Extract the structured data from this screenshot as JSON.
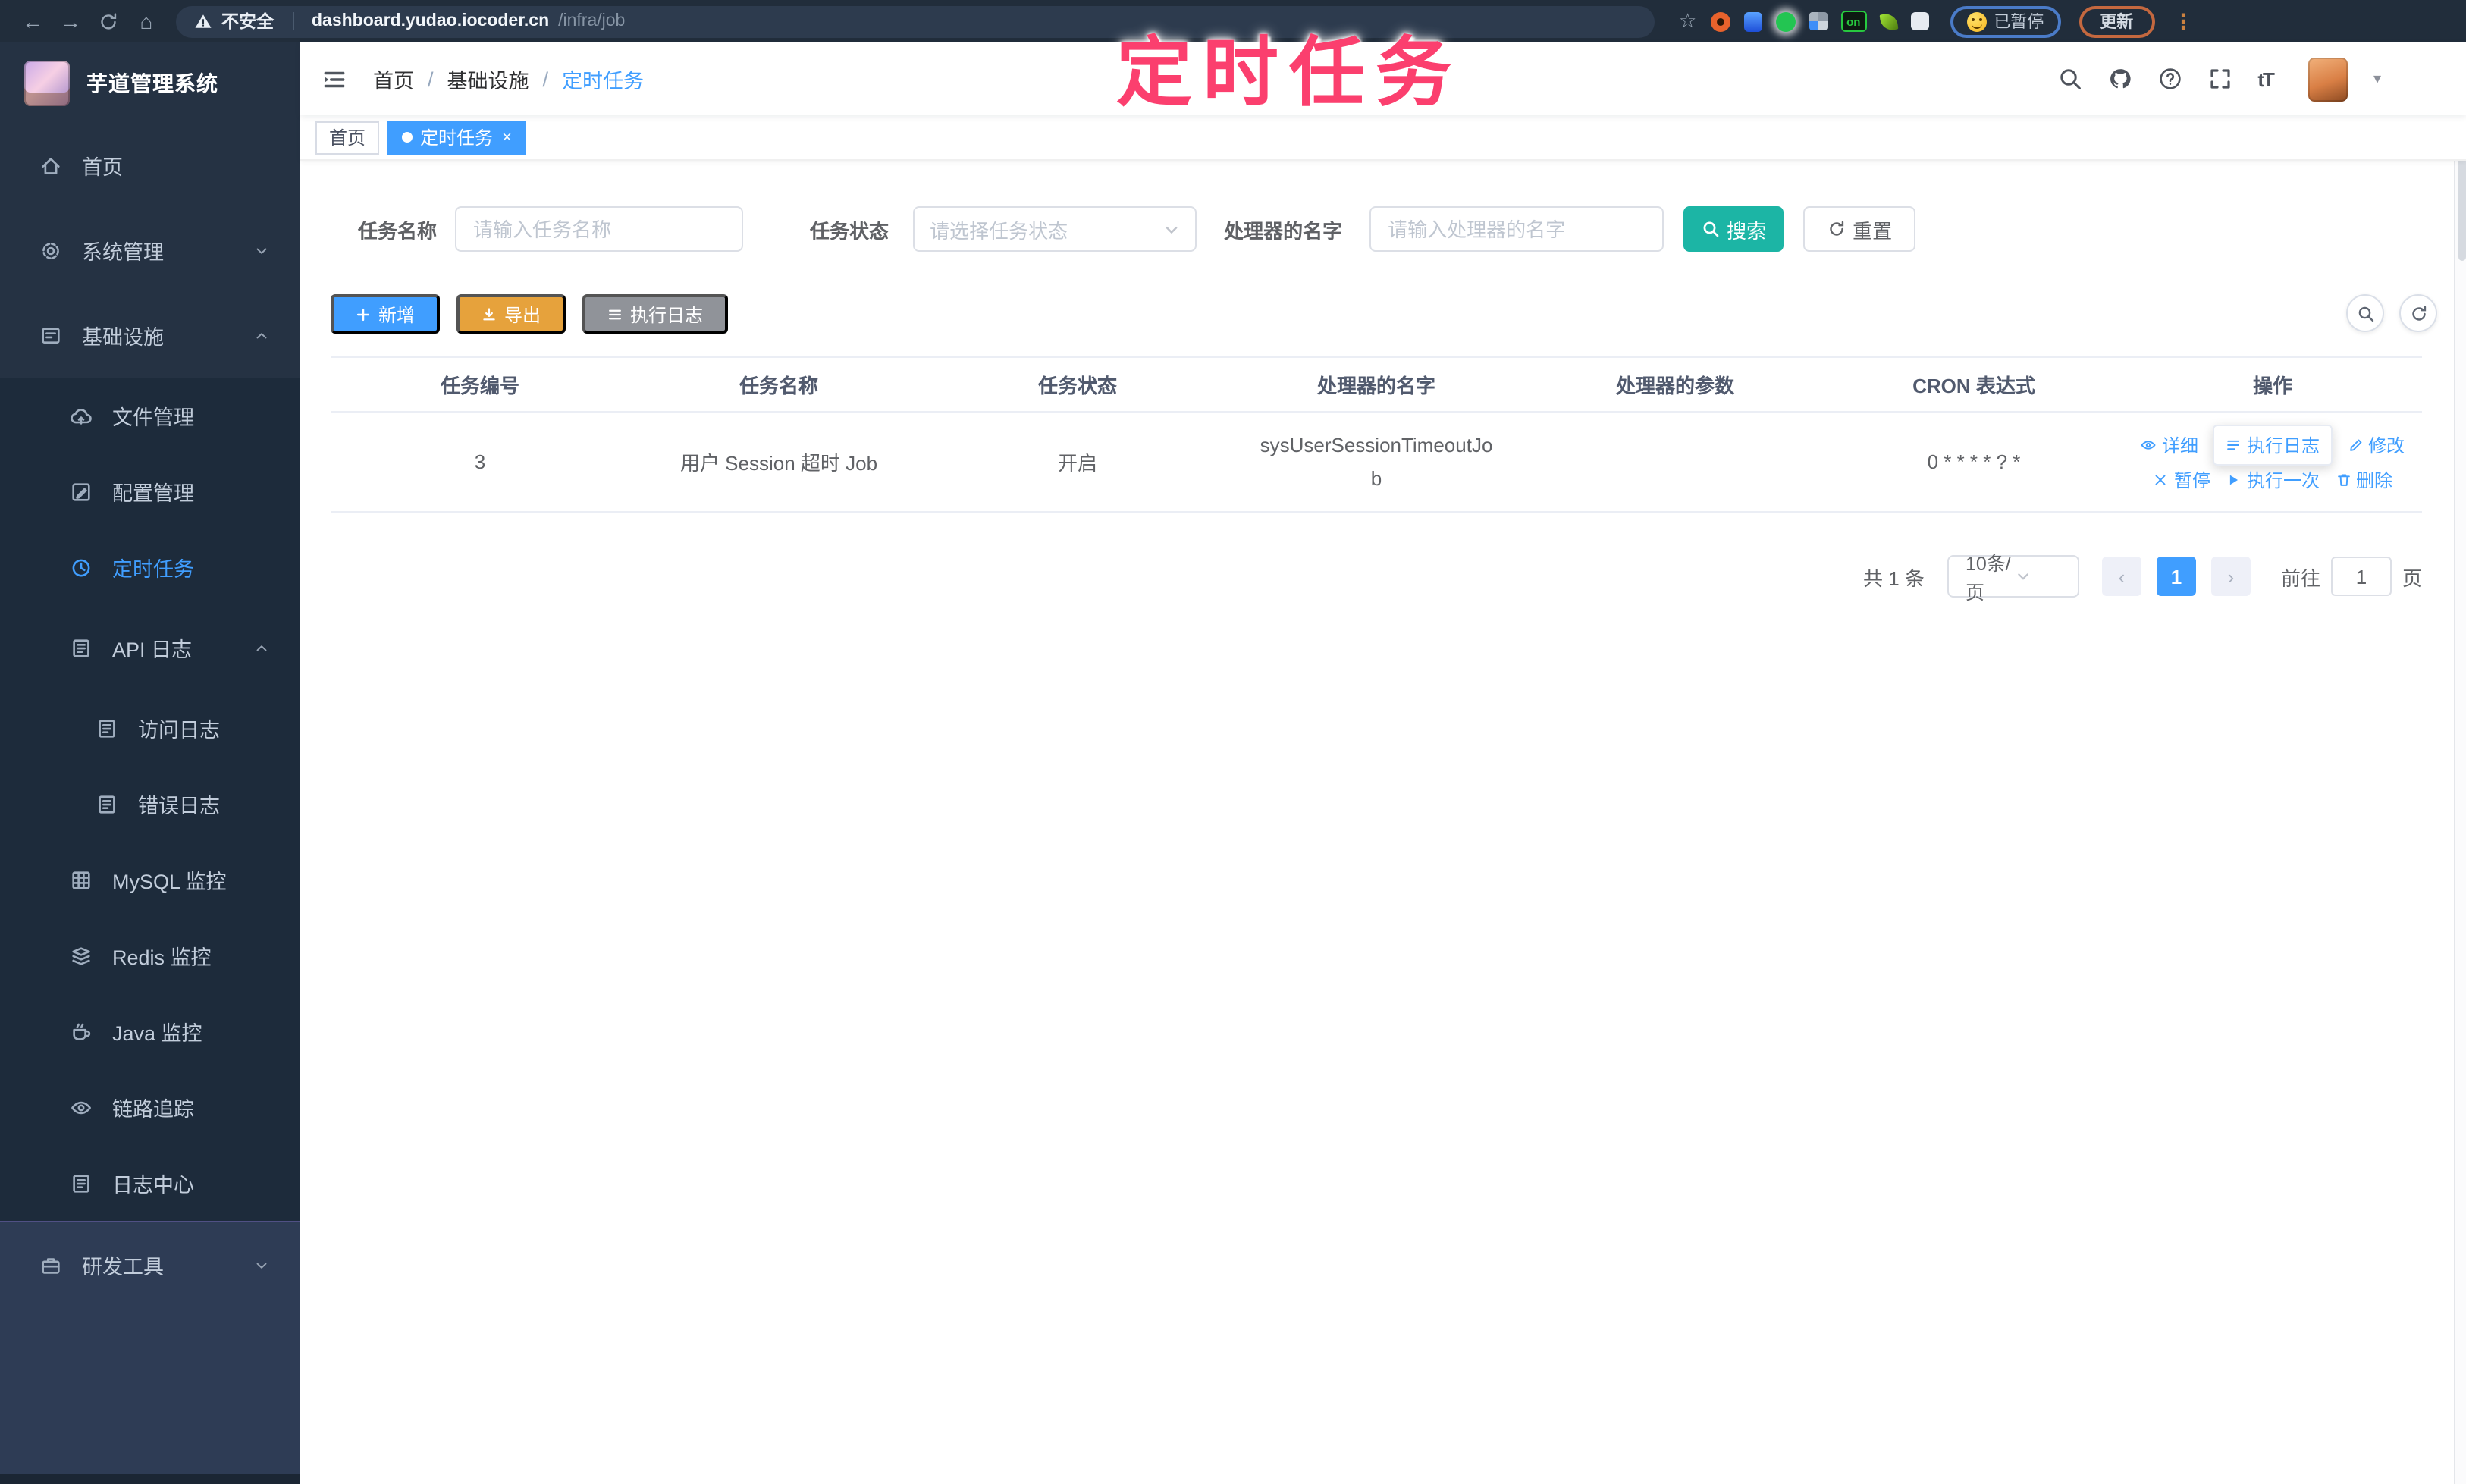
{
  "browser": {
    "security_label": "不安全",
    "url_host": "dashboard.yudao.iocoder.cn",
    "url_path": "/infra/job",
    "extensions_badge": "on",
    "profile_paused": "已暂停",
    "update_button": "更新"
  },
  "annotation": {
    "text": "定时任务"
  },
  "sidebar": {
    "title": "芋道管理系统",
    "menu": [
      {
        "key": "home",
        "label": "首页",
        "icon": "home-icon",
        "level": 0,
        "zone": "top"
      },
      {
        "key": "system-mgmt",
        "label": "系统管理",
        "icon": "gear-icon",
        "level": 0,
        "zone": "top",
        "arrow": "down"
      },
      {
        "key": "infra",
        "label": "基础设施",
        "icon": "infra-board-icon",
        "level": 0,
        "zone": "top",
        "arrow": "up"
      },
      {
        "key": "file-mgmt",
        "label": "文件管理",
        "icon": "cloud-upload-icon",
        "level": 1,
        "zone": "sub"
      },
      {
        "key": "config-mgmt",
        "label": "配置管理",
        "icon": "config-edit-icon",
        "level": 1,
        "zone": "sub"
      },
      {
        "key": "job",
        "label": "定时任务",
        "icon": "clock-icon",
        "level": 1,
        "zone": "sub",
        "active": true
      },
      {
        "key": "api-log",
        "label": "API 日志",
        "icon": "api-log-icon",
        "level": 1,
        "zone": "sub",
        "arrow": "up",
        "tall": true
      },
      {
        "key": "access-log",
        "label": "访问日志",
        "icon": "access-log-icon",
        "level": 2,
        "zone": "sub"
      },
      {
        "key": "error-log",
        "label": "错误日志",
        "icon": "error-log-icon",
        "level": 2,
        "zone": "sub"
      },
      {
        "key": "mysql",
        "label": "MySQL 监控",
        "icon": "mysql-grid-icon",
        "level": 1,
        "zone": "sub"
      },
      {
        "key": "redis",
        "label": "Redis 监控",
        "icon": "redis-stack-icon",
        "level": 1,
        "zone": "sub"
      },
      {
        "key": "java",
        "label": "Java 监控",
        "icon": "java-cup-icon",
        "level": 1,
        "zone": "sub"
      },
      {
        "key": "trace",
        "label": "链路追踪",
        "icon": "trace-eye-icon",
        "level": 1,
        "zone": "sub"
      },
      {
        "key": "log-center",
        "label": "日志中心",
        "icon": "log-center-icon",
        "level": 1,
        "zone": "sub"
      },
      {
        "key": "devtools",
        "label": "研发工具",
        "icon": "devtools-briefcase-icon",
        "level": 0,
        "zone": "bottom",
        "arrow": "down"
      }
    ]
  },
  "navbar": {
    "breadcrumb": [
      "首页",
      "基础设施",
      "定时任务"
    ]
  },
  "tags": [
    {
      "key": "home",
      "label": "首页",
      "active": false
    },
    {
      "key": "job",
      "label": "定时任务",
      "active": true,
      "closable": true
    }
  ],
  "filters": {
    "name_label": "任务名称",
    "name_placeholder": "请输入任务名称",
    "status_label": "任务状态",
    "status_placeholder": "请选择任务状态",
    "handler_label": "处理器的名字",
    "handler_placeholder": "请输入处理器的名字",
    "search_button": "搜索",
    "reset_button": "重置"
  },
  "toolbar": {
    "add_button": "新增",
    "export_button": "导出",
    "job_log_button": "执行日志"
  },
  "table": {
    "columns": [
      "任务编号",
      "任务名称",
      "任务状态",
      "处理器的名字",
      "处理器的参数",
      "CRON 表达式",
      "操作"
    ],
    "rows": [
      {
        "id": "3",
        "name": "用户 Session 超时 Job",
        "status": "开启",
        "handler_name": "sysUserSessionTimeoutJob",
        "handler_param": "",
        "cron": "0 * * * * ? *",
        "actions_row1": [
          {
            "key": "detail",
            "label": "详细",
            "icon": "detail-eye-icon"
          },
          {
            "key": "job-log",
            "label": "执行日志",
            "icon": "log-list-icon",
            "boxed": true
          },
          {
            "key": "edit",
            "label": "修改",
            "icon": "edit-pencil-icon"
          }
        ],
        "actions_row2": [
          {
            "key": "pause",
            "label": "暂停",
            "icon": "pause-x-icon"
          },
          {
            "key": "run-once",
            "label": "执行一次",
            "icon": "play-icon"
          },
          {
            "key": "delete",
            "label": "删除",
            "icon": "trash-icon"
          }
        ]
      }
    ]
  },
  "pagination": {
    "total_text": "共 1 条",
    "page_size": "10条/页",
    "current_page": "1",
    "goto_label": "前往",
    "goto_value": "1",
    "page_unit": "页"
  },
  "colors": {
    "primary": "#409EFF",
    "search_teal": "#1cb5a5",
    "export_orange": "#E6A23C",
    "info_gray": "#909399",
    "annotation_pink": "#fb3f6e",
    "sidebar_dark": "#253243",
    "sidebar_submenu": "#1d2b3b"
  }
}
